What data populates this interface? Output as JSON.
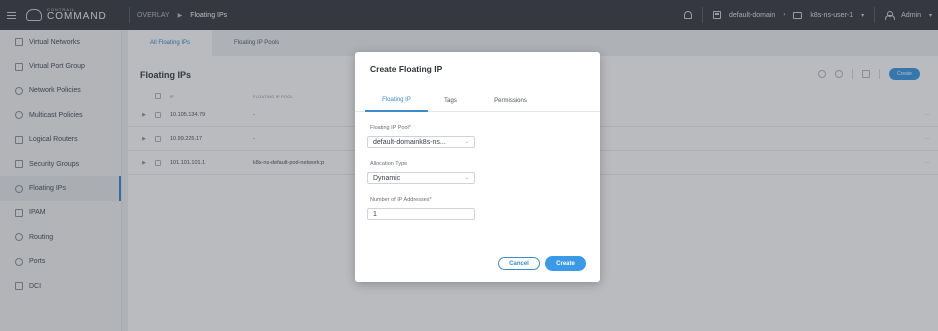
{
  "topbar": {
    "logo_small": "CONTRAIL",
    "logo_big": "COMMAND",
    "breadcrumb": [
      "OVERLAY",
      "Floating IPs"
    ],
    "domain": "default-domain",
    "project": "k8s-ns-user-1",
    "user": "Admin"
  },
  "sidebar": {
    "items": [
      {
        "label": "Virtual Networks",
        "icon": "network-icon"
      },
      {
        "label": "Virtual Port Group",
        "icon": "port-group-icon"
      },
      {
        "label": "Network Policies",
        "icon": "policy-icon"
      },
      {
        "label": "Multicast Policies",
        "icon": "multicast-icon"
      },
      {
        "label": "Logical Routers",
        "icon": "router-icon"
      },
      {
        "label": "Security Groups",
        "icon": "security-icon"
      },
      {
        "label": "Floating IPs",
        "icon": "floating-ip-icon",
        "active": true
      },
      {
        "label": "IPAM",
        "icon": "ipam-icon"
      },
      {
        "label": "Routing",
        "icon": "routing-icon"
      },
      {
        "label": "Ports",
        "icon": "ports-icon"
      },
      {
        "label": "DCI",
        "icon": "dci-icon"
      }
    ]
  },
  "main": {
    "tabs": [
      "All Floating IPs",
      "Floating IP Pools"
    ],
    "title": "Floating IPs",
    "create_label": "Create",
    "columns": [
      "IP",
      "FLOATING IP POOL"
    ],
    "rows": [
      {
        "ip": "10.105.134.79",
        "pool": "-"
      },
      {
        "ip": "10.99.225.17",
        "pool": "-"
      },
      {
        "ip": "101.101.101.1",
        "pool": "k8s-ns-default-pod-network:p"
      }
    ],
    "more": "···"
  },
  "modal": {
    "title": "Create Floating IP",
    "tabs": [
      "Floating IP",
      "Tags",
      "Permissions"
    ],
    "pool_label": "Floating IP Pool",
    "pool_value": "default-domaink8s-ns...",
    "alloc_label": "Allocation Type",
    "alloc_value": "Dynamic",
    "count_label": "Number of IP Addresses",
    "count_value": "1",
    "required_mark": "*",
    "cancel_label": "Cancel",
    "create_label": "Create"
  },
  "colors": {
    "topbar": "#3b3f48",
    "accent": "#3c8ccc",
    "primary_button": "#3a9ae8",
    "required": "#e04b4b"
  }
}
